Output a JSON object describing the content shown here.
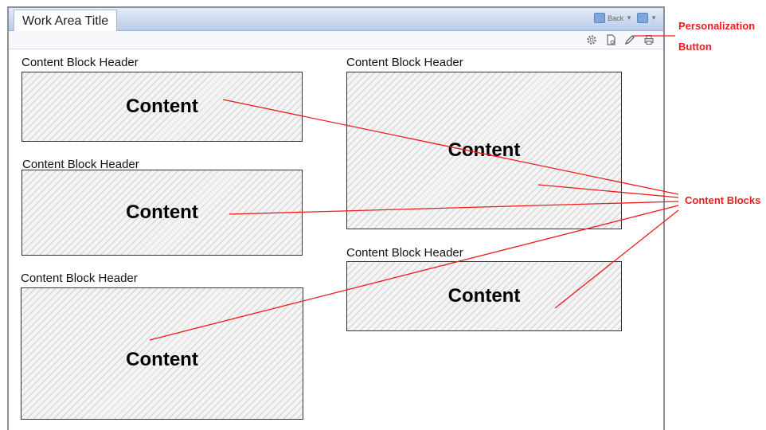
{
  "work_area": {
    "title": "Work Area Title",
    "toolbar": {
      "back_label": "Back"
    }
  },
  "blocks": [
    {
      "header": "Content Block Header",
      "content": "Content"
    },
    {
      "header": "Content Block Header",
      "content": "Content"
    },
    {
      "header": "Content Block Header",
      "content": "Content"
    },
    {
      "header": "Content Block Header",
      "content": "Content"
    },
    {
      "header": "Content Block Header",
      "content": "Content"
    }
  ],
  "annotations": {
    "personalization_line1": "Personalization",
    "personalization_line2": "Button",
    "content_blocks": "Content Blocks"
  },
  "colors": {
    "annotation": "#ee1c1c",
    "titlebar": "#b9cbe6",
    "block_border": "#333333"
  },
  "icons": [
    "gear-icon",
    "page-icon",
    "pencil-icon",
    "printer-icon"
  ]
}
